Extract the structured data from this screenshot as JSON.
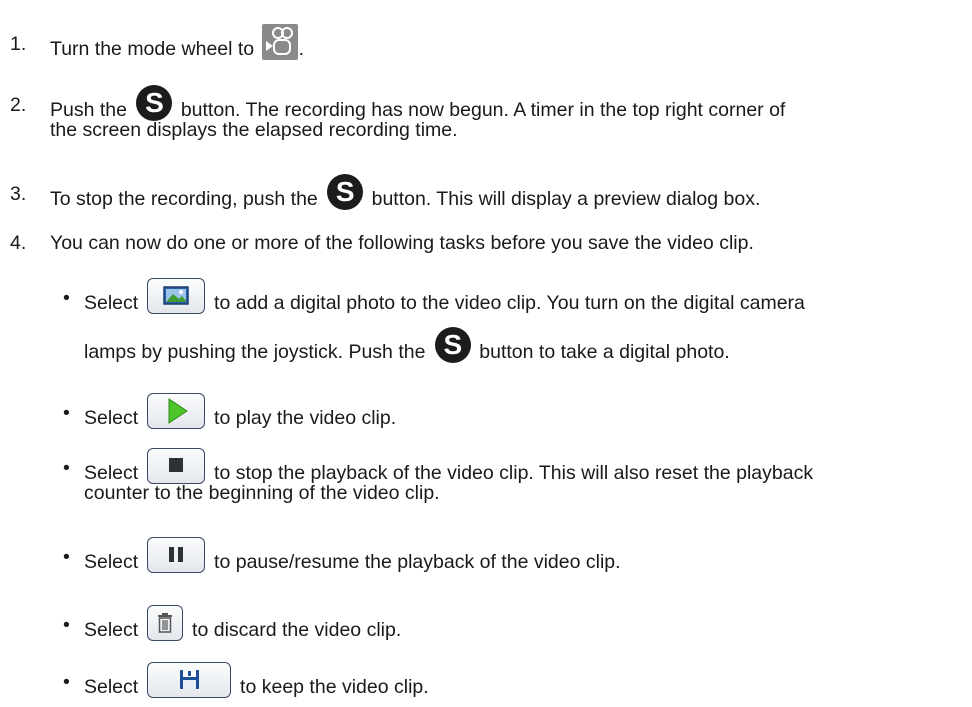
{
  "steps": [
    {
      "num": "1.",
      "parts": [
        "Turn the mode wheel to",
        "."
      ]
    },
    {
      "num": "2.",
      "parts": [
        "Push the",
        "button. The recording has now begun. A timer in the top right corner of",
        "the screen displays the elapsed recording time."
      ]
    },
    {
      "num": "3.",
      "parts": [
        "To stop the recording, push the",
        "button. This will display a preview dialog box."
      ]
    },
    {
      "num": "4.",
      "parts": [
        "You can now do one or more of the following tasks before you save the video clip."
      ]
    }
  ],
  "tasks": [
    {
      "parts": [
        "Select",
        "to add a digital photo to the video clip. You turn on the digital camera",
        "lamps by pushing the joystick. Push the",
        "button to take a digital photo."
      ]
    },
    {
      "parts": [
        "Select",
        "to play the video clip."
      ]
    },
    {
      "parts": [
        "Select",
        "to stop the playback of the video clip. This will also reset the playback",
        "counter to the beginning of the video clip."
      ]
    },
    {
      "parts": [
        "Select",
        "to pause/resume the playback of the video clip."
      ]
    },
    {
      "parts": [
        "Select",
        "to discard the video clip."
      ]
    },
    {
      "parts": [
        "Select",
        "to keep the video clip."
      ]
    }
  ],
  "bullet": "•",
  "s_button_label": "S",
  "icons": {
    "mode": "video-camera-mode-icon",
    "s_button": "s-button-icon",
    "photo": "digital-photo-button-icon",
    "play": "play-button-icon",
    "stop": "stop-button-icon",
    "pause": "pause-button-icon",
    "discard": "trash-button-icon",
    "save": "save-button-icon"
  },
  "colors": {
    "text": "#1a1a1a",
    "play_green": "#4cc52a",
    "button_border": "#3a4a66",
    "icon_dark": "#2e3136",
    "save_blue": "#1d4f96",
    "mode_gray": "#8a8a8a"
  }
}
